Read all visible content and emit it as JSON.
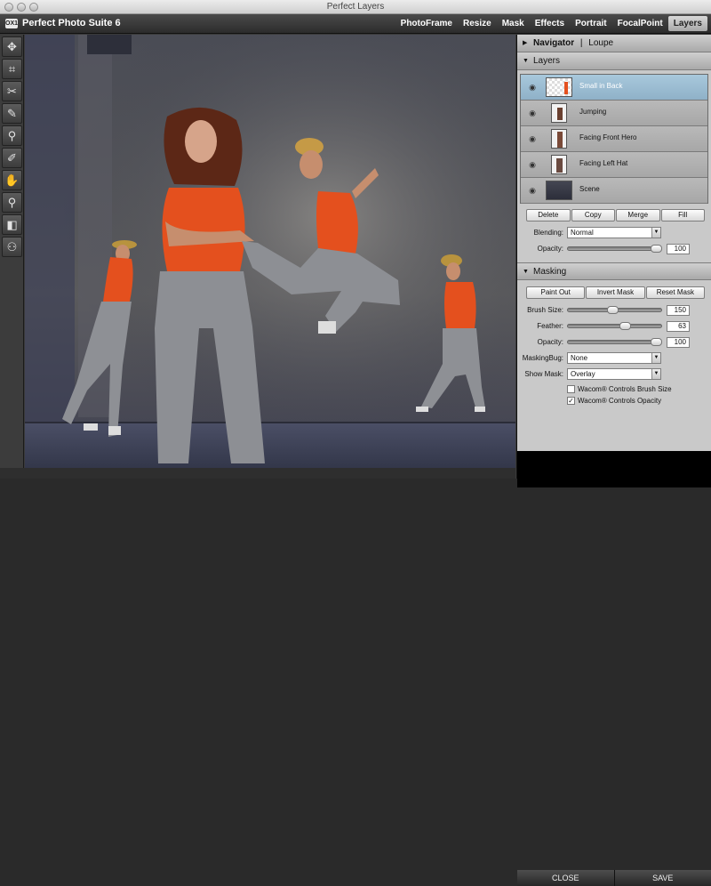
{
  "window": {
    "title": "Perfect Layers"
  },
  "app": {
    "logo_text": "OX1",
    "name": "Perfect Photo Suite 6"
  },
  "modules": [
    "PhotoFrame",
    "Resize",
    "Mask",
    "Effects",
    "Portrait",
    "FocalPoint",
    "Layers"
  ],
  "active_module": "Layers",
  "tools": [
    {
      "name": "move-tool",
      "glyph": "✥"
    },
    {
      "name": "crop-tool",
      "glyph": "⌗"
    },
    {
      "name": "scissors-tool",
      "glyph": "✂"
    },
    {
      "name": "brush-tool",
      "glyph": "✎"
    },
    {
      "name": "retouch-tool",
      "glyph": "⚲"
    },
    {
      "name": "eyedropper-tool",
      "glyph": "✐"
    },
    {
      "name": "hand-tool",
      "glyph": "✋"
    },
    {
      "name": "zoom-tool",
      "glyph": "⚲"
    },
    {
      "name": "compare-tool",
      "glyph": "◧"
    },
    {
      "name": "binoculars-tool",
      "glyph": "⚇"
    }
  ],
  "navigator": {
    "tab1": "Navigator",
    "sep": "|",
    "tab2": "Loupe"
  },
  "layers": {
    "title": "Layers",
    "items": [
      {
        "name": "Small in Back",
        "selected": true
      },
      {
        "name": "Jumping",
        "selected": false
      },
      {
        "name": "Facing Front Hero",
        "selected": false
      },
      {
        "name": "Facing Left Hat",
        "selected": false
      },
      {
        "name": "Scene",
        "selected": false
      }
    ],
    "buttons": [
      "Delete",
      "Copy",
      "Merge",
      "Fill"
    ],
    "blending_label": "Blending:",
    "blending_value": "Normal",
    "opacity_label": "Opacity:",
    "opacity_value": "100"
  },
  "masking": {
    "title": "Masking",
    "buttons": [
      "Paint Out",
      "Invert Mask",
      "Reset Mask"
    ],
    "brush_size_label": "Brush Size:",
    "brush_size_value": "150",
    "feather_label": "Feather:",
    "feather_value": "63",
    "opacity_label": "Opacity:",
    "opacity_value": "100",
    "maskingbug_label": "MaskingBug:",
    "maskingbug_value": "None",
    "showmask_label": "Show Mask:",
    "showmask_value": "Overlay",
    "wacom_brush_label": "Wacom® Controls Brush Size",
    "wacom_brush_checked": false,
    "wacom_opacity_label": "Wacom® Controls Opacity",
    "wacom_opacity_checked": true
  },
  "footer": {
    "close": "CLOSE",
    "save": "SAVE"
  },
  "colors": {
    "accent_selected": "#9dbdd2",
    "shirt_orange": "#e4501e"
  }
}
